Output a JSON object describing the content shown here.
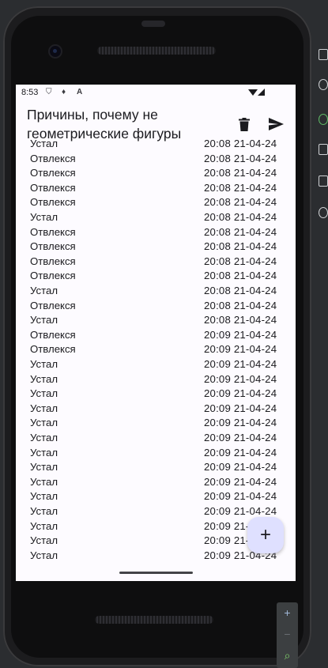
{
  "status_bar": {
    "time": "8:53"
  },
  "app_bar": {
    "title": "Причины, почему не геометрические фигуры",
    "delete_icon": "trash-icon",
    "send_icon": "send-icon"
  },
  "entries": [
    {
      "reason": "Устал",
      "stamp": "20:08 21-04-24"
    },
    {
      "reason": "Отвлекся",
      "stamp": "20:08 21-04-24"
    },
    {
      "reason": "Отвлекся",
      "stamp": "20:08 21-04-24"
    },
    {
      "reason": "Отвлекся",
      "stamp": "20:08 21-04-24"
    },
    {
      "reason": "Отвлекся",
      "stamp": "20:08 21-04-24"
    },
    {
      "reason": "Устал",
      "stamp": "20:08 21-04-24"
    },
    {
      "reason": "Отвлекся",
      "stamp": "20:08 21-04-24"
    },
    {
      "reason": "Отвлекся",
      "stamp": "20:08 21-04-24"
    },
    {
      "reason": "Отвлекся",
      "stamp": "20:08 21-04-24"
    },
    {
      "reason": "Отвлекся",
      "stamp": "20:08 21-04-24"
    },
    {
      "reason": "Устал",
      "stamp": "20:08 21-04-24"
    },
    {
      "reason": "Отвлекся",
      "stamp": "20:08 21-04-24"
    },
    {
      "reason": "Устал",
      "stamp": "20:08 21-04-24"
    },
    {
      "reason": "Отвлекся",
      "stamp": "20:09 21-04-24"
    },
    {
      "reason": "Отвлекся",
      "stamp": "20:09 21-04-24"
    },
    {
      "reason": "Устал",
      "stamp": "20:09 21-04-24"
    },
    {
      "reason": "Устал",
      "stamp": "20:09 21-04-24"
    },
    {
      "reason": "Устал",
      "stamp": "20:09 21-04-24"
    },
    {
      "reason": "Устал",
      "stamp": "20:09 21-04-24"
    },
    {
      "reason": "Устал",
      "stamp": "20:09 21-04-24"
    },
    {
      "reason": "Устал",
      "stamp": "20:09 21-04-24"
    },
    {
      "reason": "Устал",
      "stamp": "20:09 21-04-24"
    },
    {
      "reason": "Устал",
      "stamp": "20:09 21-04-24"
    },
    {
      "reason": "Устал",
      "stamp": "20:09 21-04-24"
    },
    {
      "reason": "Устал",
      "stamp": "20:09 21-04-24"
    },
    {
      "reason": "Устал",
      "stamp": "20:09 21-04-24"
    },
    {
      "reason": "Устал",
      "stamp": "20:09 21-04-24"
    },
    {
      "reason": "Устал",
      "stamp": "20:09 21-04-24"
    },
    {
      "reason": "Устал",
      "stamp": "20:09 21-04-24"
    }
  ],
  "fab": {
    "label": "+",
    "icon": "plus-icon",
    "color": "#dfe0ff"
  },
  "emulator_zoom": {
    "zoom_in": "+",
    "zoom_out": "−",
    "zoom_fit": "⌕"
  },
  "colors": {
    "screen_bg": "#fdfbff",
    "text": "#1b1b1f",
    "ide_bg": "#2b2d30"
  }
}
